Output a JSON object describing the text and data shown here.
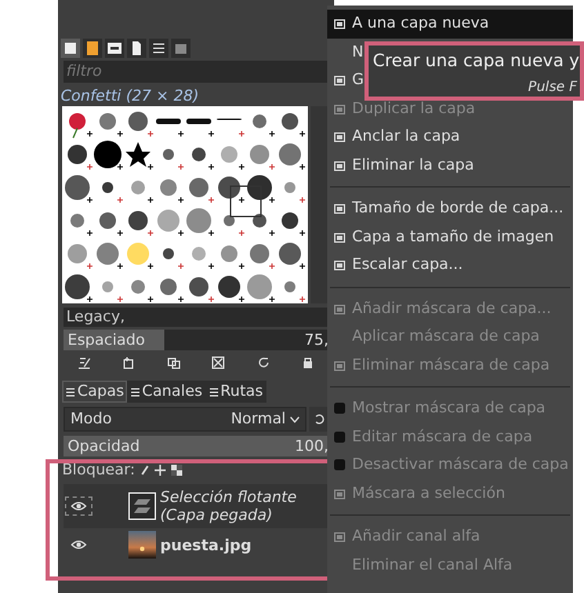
{
  "brush_tabs": [
    {
      "selected": true
    },
    {
      "selected": false
    },
    {
      "selected": false
    },
    {
      "selected": false
    },
    {
      "selected": false
    },
    {
      "selected": false
    }
  ],
  "filter": {
    "placeholder": "filtro"
  },
  "brush_name": "Confetti (27 × 28)",
  "tags": "Legacy,",
  "spacing": {
    "label": "Espaciado",
    "value": "75,",
    "level": 0.38
  },
  "layer_tabs": [
    {
      "label": "Capas",
      "selected": true
    },
    {
      "label": "Canales",
      "selected": false
    },
    {
      "label": "Rutas",
      "selected": false
    }
  ],
  "mode": {
    "label": "Modo",
    "value": "Normal"
  },
  "opacity": {
    "label": "Opacidad",
    "value": "100,",
    "level": 1
  },
  "lock_label": "Bloquear:",
  "layers": [
    {
      "name": "Selección flotante (Capa pegada)",
      "kind": "floating",
      "visible": true
    },
    {
      "name": "puesta.jpg",
      "kind": "image",
      "visible": true
    }
  ],
  "menu": {
    "items": [
      {
        "kind": "item",
        "label": "A una capa nueva",
        "highlighted": true,
        "disabled": false,
        "icon": true
      },
      {
        "kind": "item",
        "label": "N",
        "highlighted": false,
        "disabled": false,
        "icon": false
      },
      {
        "kind": "item",
        "label": "G",
        "highlighted": false,
        "disabled": false,
        "icon": true
      },
      {
        "kind": "item",
        "label": "Duplicar la capa",
        "highlighted": false,
        "disabled": true,
        "icon": true
      },
      {
        "kind": "item",
        "label": "Anclar la capa",
        "highlighted": false,
        "disabled": false,
        "icon": true
      },
      {
        "kind": "item",
        "label": "Eliminar la capa",
        "highlighted": false,
        "disabled": false,
        "icon": true
      },
      {
        "kind": "separator"
      },
      {
        "kind": "item",
        "label": "Tamaño de borde de capa...",
        "highlighted": false,
        "disabled": false,
        "icon": true
      },
      {
        "kind": "item",
        "label": "Capa a tamaño de imagen",
        "highlighted": false,
        "disabled": false,
        "icon": true
      },
      {
        "kind": "item",
        "label": "Escalar capa...",
        "highlighted": false,
        "disabled": false,
        "icon": true
      },
      {
        "kind": "separator"
      },
      {
        "kind": "item",
        "label": "Añadir máscara de capa...",
        "highlighted": false,
        "disabled": true,
        "icon": true
      },
      {
        "kind": "item",
        "label": "Aplicar máscara de capa",
        "highlighted": false,
        "disabled": true,
        "icon": false
      },
      {
        "kind": "item",
        "label": "Eliminar máscara de capa",
        "highlighted": false,
        "disabled": true,
        "icon": true
      },
      {
        "kind": "separator"
      },
      {
        "kind": "toggle",
        "label": "Mostrar máscara de capa",
        "checked": false,
        "disabled": true
      },
      {
        "kind": "toggle",
        "label": "Editar máscara de capa",
        "checked": false,
        "disabled": true
      },
      {
        "kind": "toggle",
        "label": "Desactivar máscara de capa",
        "checked": false,
        "disabled": true
      },
      {
        "kind": "item",
        "label": "Máscara a selección",
        "highlighted": false,
        "disabled": true,
        "icon": true
      },
      {
        "kind": "separator"
      },
      {
        "kind": "item",
        "label": "Añadir canal alfa",
        "highlighted": false,
        "disabled": true,
        "icon": true
      },
      {
        "kind": "item",
        "label": "Eliminar el canal Alfa",
        "highlighted": false,
        "disabled": true,
        "icon": false
      }
    ]
  },
  "tooltip": {
    "text": "Crear una capa nueva y",
    "hint": "Pulse F"
  }
}
